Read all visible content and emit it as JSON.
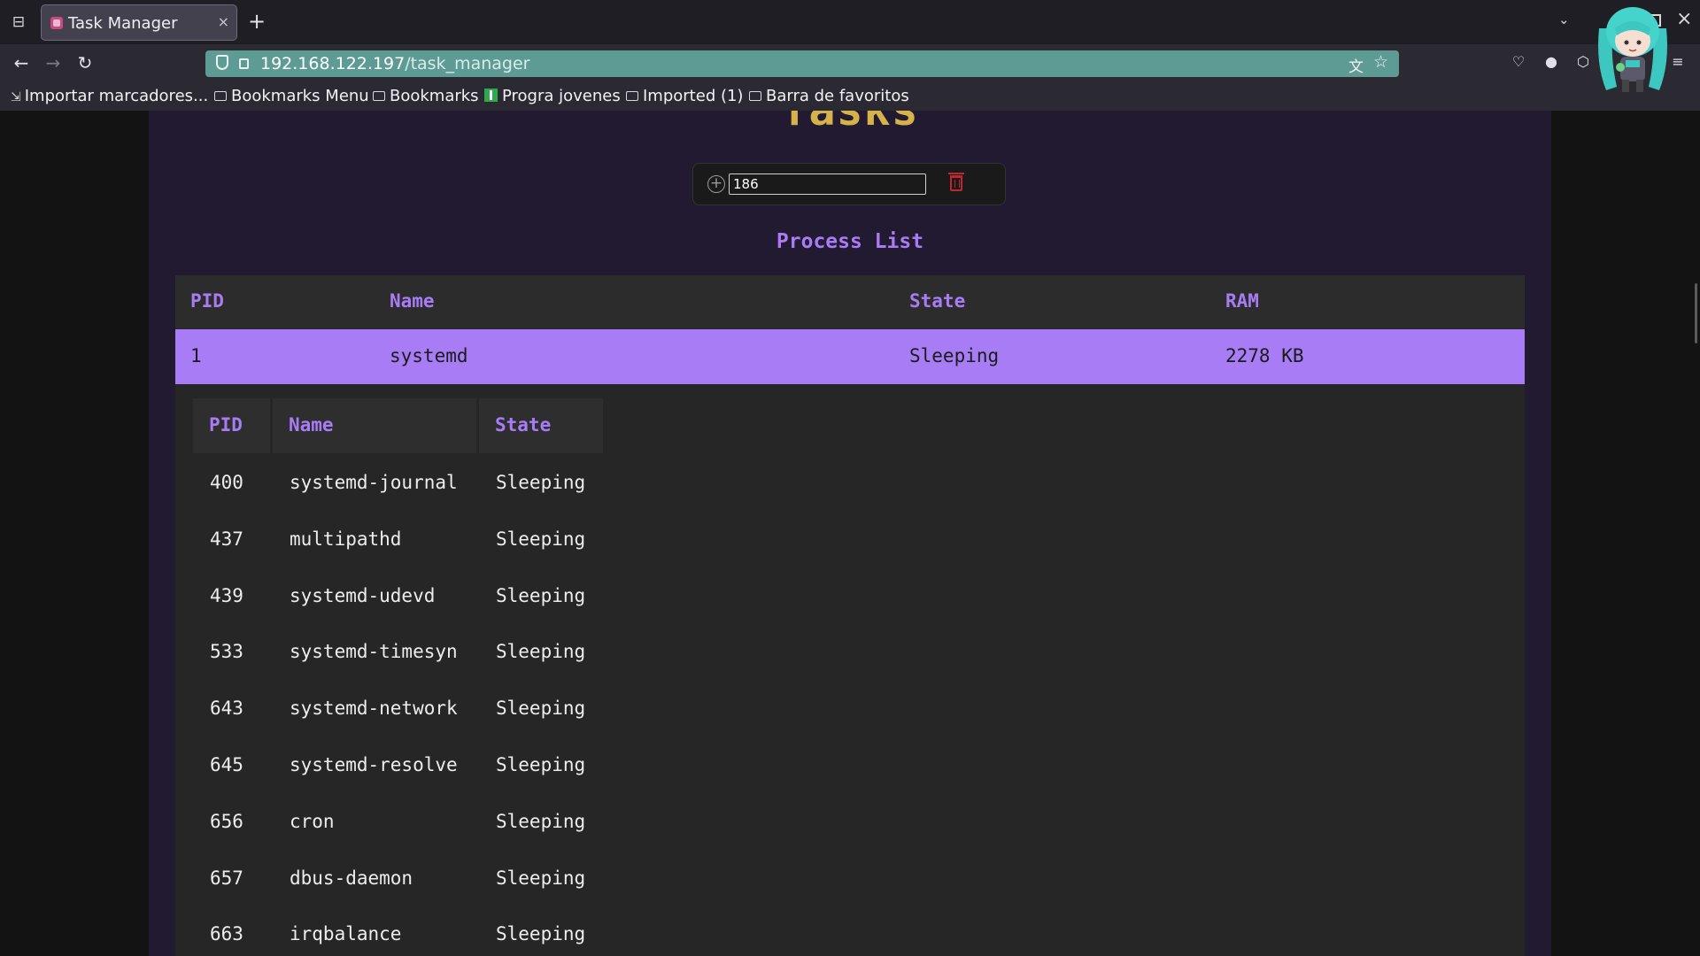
{
  "browser": {
    "tab_title": "Task Manager",
    "tab_close": "×",
    "new_tab": "+",
    "url_host": "192.168.122.197",
    "url_path": "/task_manager",
    "bookmarks": [
      {
        "label": "Importar marcadores..."
      },
      {
        "label": "Bookmarks Menu"
      },
      {
        "label": "Bookmarks"
      },
      {
        "label": "Progra jovenes"
      },
      {
        "label": "Imported (1)"
      },
      {
        "label": "Barra de favoritos"
      }
    ]
  },
  "page": {
    "heading": "Tasks",
    "search_value": "186",
    "list_title": "Process List",
    "main_table": {
      "headers": {
        "pid": "PID",
        "name": "Name",
        "state": "State",
        "ram": "RAM"
      },
      "row": {
        "pid": "1",
        "name": "systemd",
        "state": "Sleeping",
        "ram": "2278 KB"
      }
    },
    "children_table": {
      "headers": {
        "pid": "PID",
        "name": "Name",
        "state": "State"
      },
      "rows": [
        {
          "pid": "400",
          "name": "systemd-journal",
          "state": "Sleeping"
        },
        {
          "pid": "437",
          "name": "multipathd",
          "state": "Sleeping"
        },
        {
          "pid": "439",
          "name": "systemd-udevd",
          "state": "Sleeping"
        },
        {
          "pid": "533",
          "name": "systemd-timesyn",
          "state": "Sleeping"
        },
        {
          "pid": "643",
          "name": "systemd-network",
          "state": "Sleeping"
        },
        {
          "pid": "645",
          "name": "systemd-resolve",
          "state": "Sleeping"
        },
        {
          "pid": "656",
          "name": "cron",
          "state": "Sleeping"
        },
        {
          "pid": "657",
          "name": "dbus-daemon",
          "state": "Sleeping"
        },
        {
          "pid": "663",
          "name": "irqbalance",
          "state": "Sleeping"
        }
      ]
    }
  },
  "colors": {
    "accent": "#a87cf4",
    "heading": "#d6b34a",
    "panel": "#211a30",
    "urlbar": "#5f9b95",
    "delete": "#c0262c"
  },
  "icons": [
    "tab-list-icon",
    "back-icon",
    "forward-icon",
    "reload-icon",
    "shield-icon",
    "lock-icon",
    "translate-icon",
    "star-icon",
    "pocket-icon",
    "extension-icon",
    "menu-icon",
    "plus-circle-icon",
    "trash-icon",
    "folder-icon"
  ]
}
